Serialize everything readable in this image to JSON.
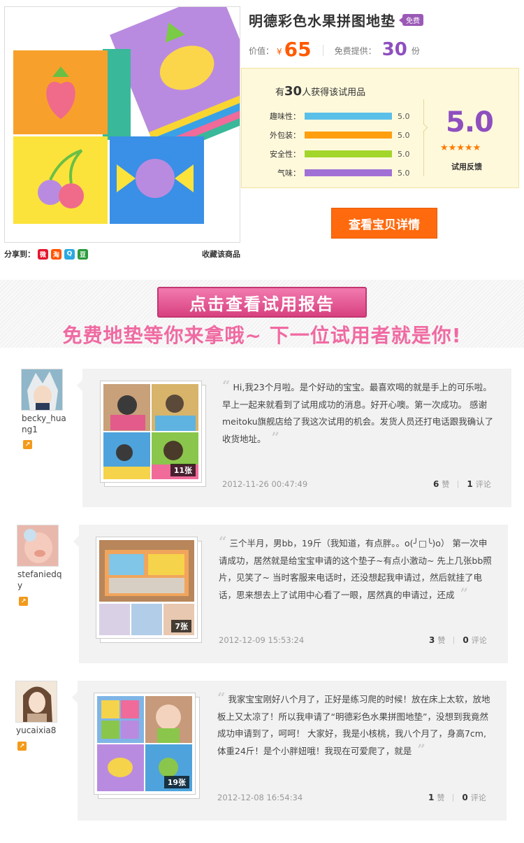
{
  "product": {
    "title": "明德彩色水果拼图地垫",
    "free_badge": "免费",
    "price_label": "价值：",
    "currency": "¥",
    "price": "65",
    "offer_label": "免费提供：",
    "offer_count": "30",
    "offer_unit": "份",
    "share_label": "分享到：",
    "share_icons": [
      {
        "name": "weibo-icon",
        "glyph": "微",
        "color": "#e6162d"
      },
      {
        "name": "taobao-icon",
        "glyph": "淘",
        "color": "#ff5500"
      },
      {
        "name": "qzone-icon",
        "glyph": "Q",
        "color": "#2ba8e0"
      },
      {
        "name": "douban-icon",
        "glyph": "豆",
        "color": "#2a9b3c"
      }
    ],
    "favorite_label": "收藏该商品",
    "detail_button": "查看宝贝详情"
  },
  "rating": {
    "winners_prefix": "有",
    "winners_count": "30",
    "winners_suffix": "人获得该试用品",
    "items": [
      {
        "label": "趣味性：",
        "value": "5.0",
        "color": "#5bc0e8"
      },
      {
        "label": "外包装：",
        "value": "5.0",
        "color": "#ff9f10"
      },
      {
        "label": "安全性：",
        "value": "5.0",
        "color": "#a2d62b"
      },
      {
        "label": "气味：",
        "value": "5.0",
        "color": "#a170d6"
      }
    ],
    "overall": "5.0",
    "stars": "★★★★★",
    "overall_label": "试用反馈"
  },
  "banner": {
    "button": "点击查看试用报告",
    "slogan": "免费地垫等你来拿哦~ 下一位试用者就是你!"
  },
  "reviews": [
    {
      "username": "becky_huang1",
      "level": "Lv",
      "text": "Hi,我23个月啦。是个好动的宝宝。最喜欢喝的就是手上的可乐啦。 早上一起来就看到了试用成功的消息。好开心噢。第一次成功。 感谢meitoku旗舰店给了我这次试用的机会。发货人员还打电话跟我确认了收货地址。",
      "photo_count": "11张",
      "date": "2012-11-26 00:47:49",
      "likes": "6",
      "likes_label": "赞",
      "comments": "1",
      "comments_label": "评论"
    },
    {
      "username": "stefaniedqy",
      "level": "Lv",
      "text": "三个半月，男bb，19斤（我知道，有点胖。。o(╯□╰)o） 第一次申请成功，居然就是给宝宝申请的这个垫子~有点小激动~ 先上几张bb照片，见笑了~ 当时客服来电话时，还没想起我申请过，然后就挂了电话，思来想去上了试用中心看了一眼，居然真的申请过，还成",
      "photo_count": "7张",
      "date": "2012-12-09 15:53:24",
      "likes": "3",
      "likes_label": "赞",
      "comments": "0",
      "comments_label": "评论"
    },
    {
      "username": "yucaixia8",
      "level": "Lv",
      "text": "我家宝宝刚好八个月了，正好是练习爬的时候！放在床上太软，放地板上又太凉了！所以我申请了“明德彩色水果拼图地垫”，没想到我竟然成功申请到了，呵呵！ 大家好，我是小核桃，我八个月了，身高7cm,体重24斤！是个小胖妞哦！我现在可爱爬了，就是",
      "photo_count": "19张",
      "date": "2012-12-08 16:54:34",
      "likes": "1",
      "likes_label": "赞",
      "comments": "0",
      "comments_label": "评论"
    }
  ]
}
